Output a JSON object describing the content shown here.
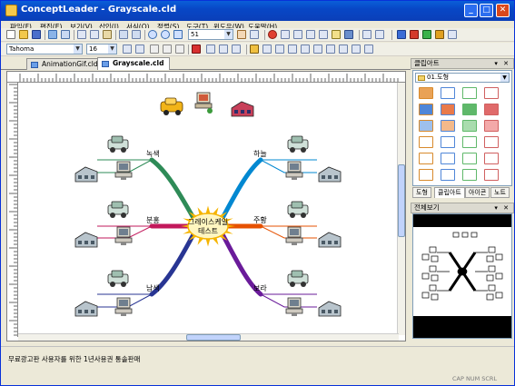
{
  "window": {
    "title": "ConceptLeader - Grayscale.cld",
    "minimize_glyph": "_",
    "maximize_glyph": "□",
    "close_glyph": "✕"
  },
  "menu": [
    "파일(F)",
    "편집(E)",
    "보기(V)",
    "삽입(I)",
    "서식(O)",
    "정렬(S)",
    "도구(T)",
    "윈도우(W)",
    "도움말(H)"
  ],
  "toolbar": {
    "zoom_value": "51",
    "font_name": "Tahoma",
    "font_size": "16"
  },
  "tabs": [
    {
      "label": "AnimationGif.cld",
      "active": false
    },
    {
      "label": "Grayscale.cld",
      "active": true
    }
  ],
  "map": {
    "center": {
      "line1": "그레이스케일",
      "line2": "테스트"
    },
    "branches": [
      {
        "label": "녹색",
        "color": "#2e8b57"
      },
      {
        "label": "분홍",
        "color": "#c2185b"
      },
      {
        "label": "남색",
        "color": "#283593"
      },
      {
        "label": "하늘",
        "color": "#0288d1"
      },
      {
        "label": "주황",
        "color": "#e65100"
      },
      {
        "label": "보라",
        "color": "#6a1b9a"
      }
    ]
  },
  "panels": {
    "clipart": {
      "title": "클립아트",
      "category": "01.도형",
      "pin_close": "▾ ✕",
      "tabs": [
        "도형",
        "클립아트",
        "아이콘",
        "노트"
      ]
    },
    "overview": {
      "title": "전체보기",
      "pin_close": "▾ ✕"
    }
  },
  "status": {
    "message": "무료광고판 사용자를 위한 1년사용권 통솔판매",
    "indicators": "CAP  NUM  SCRL"
  },
  "colors": {
    "titlebar": "#0a4fd0",
    "center_fill": "#fff6c0",
    "sun": "#f5b400"
  }
}
